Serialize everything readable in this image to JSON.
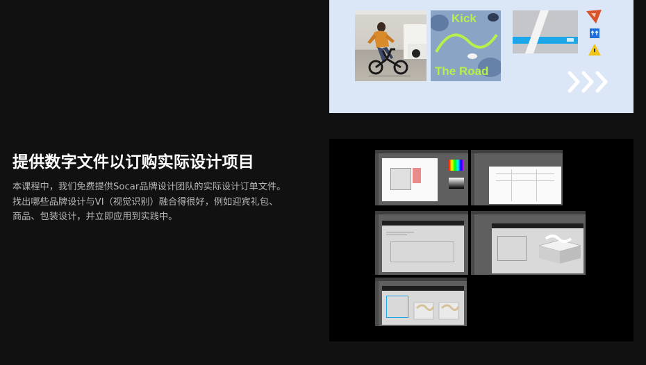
{
  "section": {
    "title": "提供数字文件以订购实际设计项目",
    "description_lines": [
      "本课程中，我们免费提供Socar品牌设计团队的实际设计订单文件。",
      "找出哪些品牌设计与VI（视觉识别）融合得很好，例如迎宾礼包、",
      "商品、包装设计，并立即应用到实践中。"
    ]
  },
  "top_panel": {
    "background": "#dbe6f7",
    "poster": {
      "line1": "Kick",
      "line2": "The Road",
      "text_color": "#b7f04a"
    },
    "box_accent": "#1ea7e8",
    "icons": [
      "triangle-label-icon",
      "arrow-up-label-icon",
      "warning-label-icon",
      "chevron-arrows-icon"
    ]
  },
  "collage": {
    "screens": [
      "illustrator-screen-1",
      "illustrator-screen-2",
      "illustrator-screen-3",
      "illustrator-screen-4",
      "illustrator-screen-5"
    ]
  },
  "colors": {
    "page_bg": "#111111",
    "title": "#ffffff",
    "body_text": "#b9b9b9"
  }
}
